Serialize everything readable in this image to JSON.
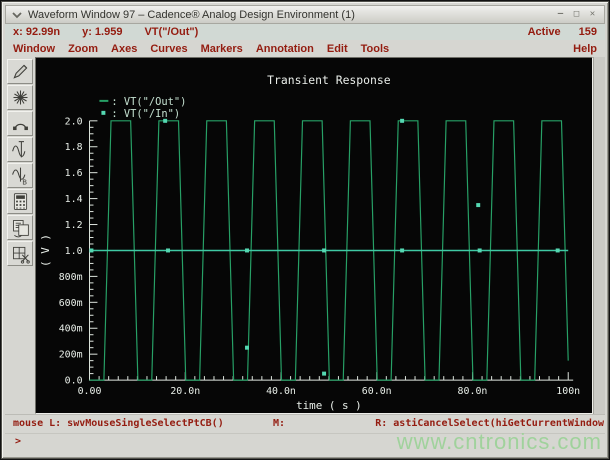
{
  "window": {
    "title": "Waveform Window 97 – Cadence® Analog Design Environment (1)",
    "controls": [
      {
        "name": "minimize-button",
        "glyph": "–"
      },
      {
        "name": "maximize-button",
        "glyph": "□"
      },
      {
        "name": "close-button",
        "glyph": "✕"
      }
    ]
  },
  "readout": {
    "x": "x: 92.99n",
    "y": "y: 1.959",
    "trace": "VT(\"/Out\")",
    "active_label": "Active",
    "active_count": "159"
  },
  "menus": [
    "Window",
    "Zoom",
    "Axes",
    "Curves",
    "Markers",
    "Annotation",
    "Edit",
    "Tools"
  ],
  "help_menu": "Help",
  "toolbar": {
    "icons": [
      "pen-icon",
      "starburst-icon",
      "arc-probe-icon",
      "marker-a-icon",
      "marker-b-icon",
      "calculator-icon",
      "copy-window-icon",
      "subwindow-cut-icon"
    ]
  },
  "colors": {
    "menu_text": "#941c10",
    "plot_bg": "#060606",
    "axis": "#dfe6df",
    "label_text": "#e8eee8",
    "title_text": "#eaeeea",
    "legend_text": "#c4e0d0",
    "out_trace": "#27a066",
    "in_trace": "#3fc9a4",
    "marker": "#55d8b2",
    "watermark": "#9ed29a"
  },
  "chart_data": {
    "type": "line",
    "title": "Transient Response",
    "xlabel": "time ( s )",
    "ylabel": "( V )",
    "xlim": [
      0,
      100
    ],
    "x_unit": "ns",
    "ylim": [
      0,
      2
    ],
    "grid": false,
    "legend_position": "top-left",
    "x_ticks": [
      {
        "t": 0,
        "label": "0.00"
      },
      {
        "t": 20,
        "label": "20.0n"
      },
      {
        "t": 40,
        "label": "40.0n"
      },
      {
        "t": 60,
        "label": "60.0n"
      },
      {
        "t": 80,
        "label": "80.0n"
      },
      {
        "t": 100,
        "label": "100n"
      }
    ],
    "y_ticks": [
      {
        "v": 2.0,
        "label": "2.0"
      },
      {
        "v": 1.8,
        "label": "1.8"
      },
      {
        "v": 1.6,
        "label": "1.6"
      },
      {
        "v": 1.4,
        "label": "1.4"
      },
      {
        "v": 1.2,
        "label": "1.2"
      },
      {
        "v": 1.0,
        "label": "1.0"
      },
      {
        "v": 0.8,
        "label": "800m"
      },
      {
        "v": 0.6,
        "label": "600m"
      },
      {
        "v": 0.4,
        "label": "400m"
      },
      {
        "v": 0.2,
        "label": "200m"
      },
      {
        "v": 0.0,
        "label": "0.0"
      }
    ],
    "x_minor_step": 2,
    "y_minor_step": 0.05,
    "series": [
      {
        "name": "VT(\"/Out\")",
        "color": "#27a066",
        "legend_glyph": "dash",
        "period_ns": 10,
        "points": [
          [
            0,
            0
          ],
          [
            3,
            0
          ],
          [
            4.5,
            2
          ],
          [
            8.6,
            2
          ],
          [
            10.1,
            0
          ],
          [
            13,
            0
          ],
          [
            14.5,
            2
          ],
          [
            18.6,
            2
          ],
          [
            20.1,
            0
          ],
          [
            23,
            0
          ],
          [
            24.5,
            2
          ],
          [
            28.6,
            2
          ],
          [
            30.1,
            0
          ],
          [
            33,
            0
          ],
          [
            34.5,
            2
          ],
          [
            38.6,
            2
          ],
          [
            40.1,
            0
          ],
          [
            43,
            0
          ],
          [
            44.5,
            2
          ],
          [
            48.6,
            2
          ],
          [
            50.1,
            0
          ],
          [
            53,
            0
          ],
          [
            54.5,
            2
          ],
          [
            58.6,
            2
          ],
          [
            60.1,
            0
          ],
          [
            63,
            0
          ],
          [
            64.5,
            2
          ],
          [
            68.6,
            2
          ],
          [
            70.1,
            0
          ],
          [
            73,
            0
          ],
          [
            74.5,
            2
          ],
          [
            78.6,
            2
          ],
          [
            80.1,
            0
          ],
          [
            83,
            0
          ],
          [
            84.5,
            2
          ],
          [
            88.6,
            2
          ],
          [
            90.1,
            0
          ],
          [
            93,
            0
          ],
          [
            94.5,
            2
          ],
          [
            98.6,
            2
          ],
          [
            100,
            0.15
          ]
        ],
        "markers": [
          [
            15.8,
            2
          ],
          [
            32.9,
            0.25
          ],
          [
            49.0,
            0.05
          ],
          [
            65.3,
            2
          ],
          [
            81.2,
            1.35
          ]
        ]
      },
      {
        "name": "VT(\"/In\")",
        "color": "#3fc9a4",
        "legend_glyph": "dot",
        "points": [
          [
            0,
            1
          ],
          [
            100,
            1
          ]
        ],
        "markers": [
          [
            0.4,
            1
          ],
          [
            16.4,
            1
          ],
          [
            32.9,
            1
          ],
          [
            49.0,
            1
          ],
          [
            65.3,
            1
          ],
          [
            81.5,
            1
          ],
          [
            97.8,
            1
          ]
        ]
      }
    ]
  },
  "status_bar": {
    "left": "mouse L: swvMouseSingleSelectPtCB()",
    "middle": "M:",
    "right": "R: astiCancelSelect(hiGetCurrentWindow"
  },
  "prompt": {
    "symbol": ">"
  },
  "watermark": {
    "text": "www.cntronics.com"
  }
}
